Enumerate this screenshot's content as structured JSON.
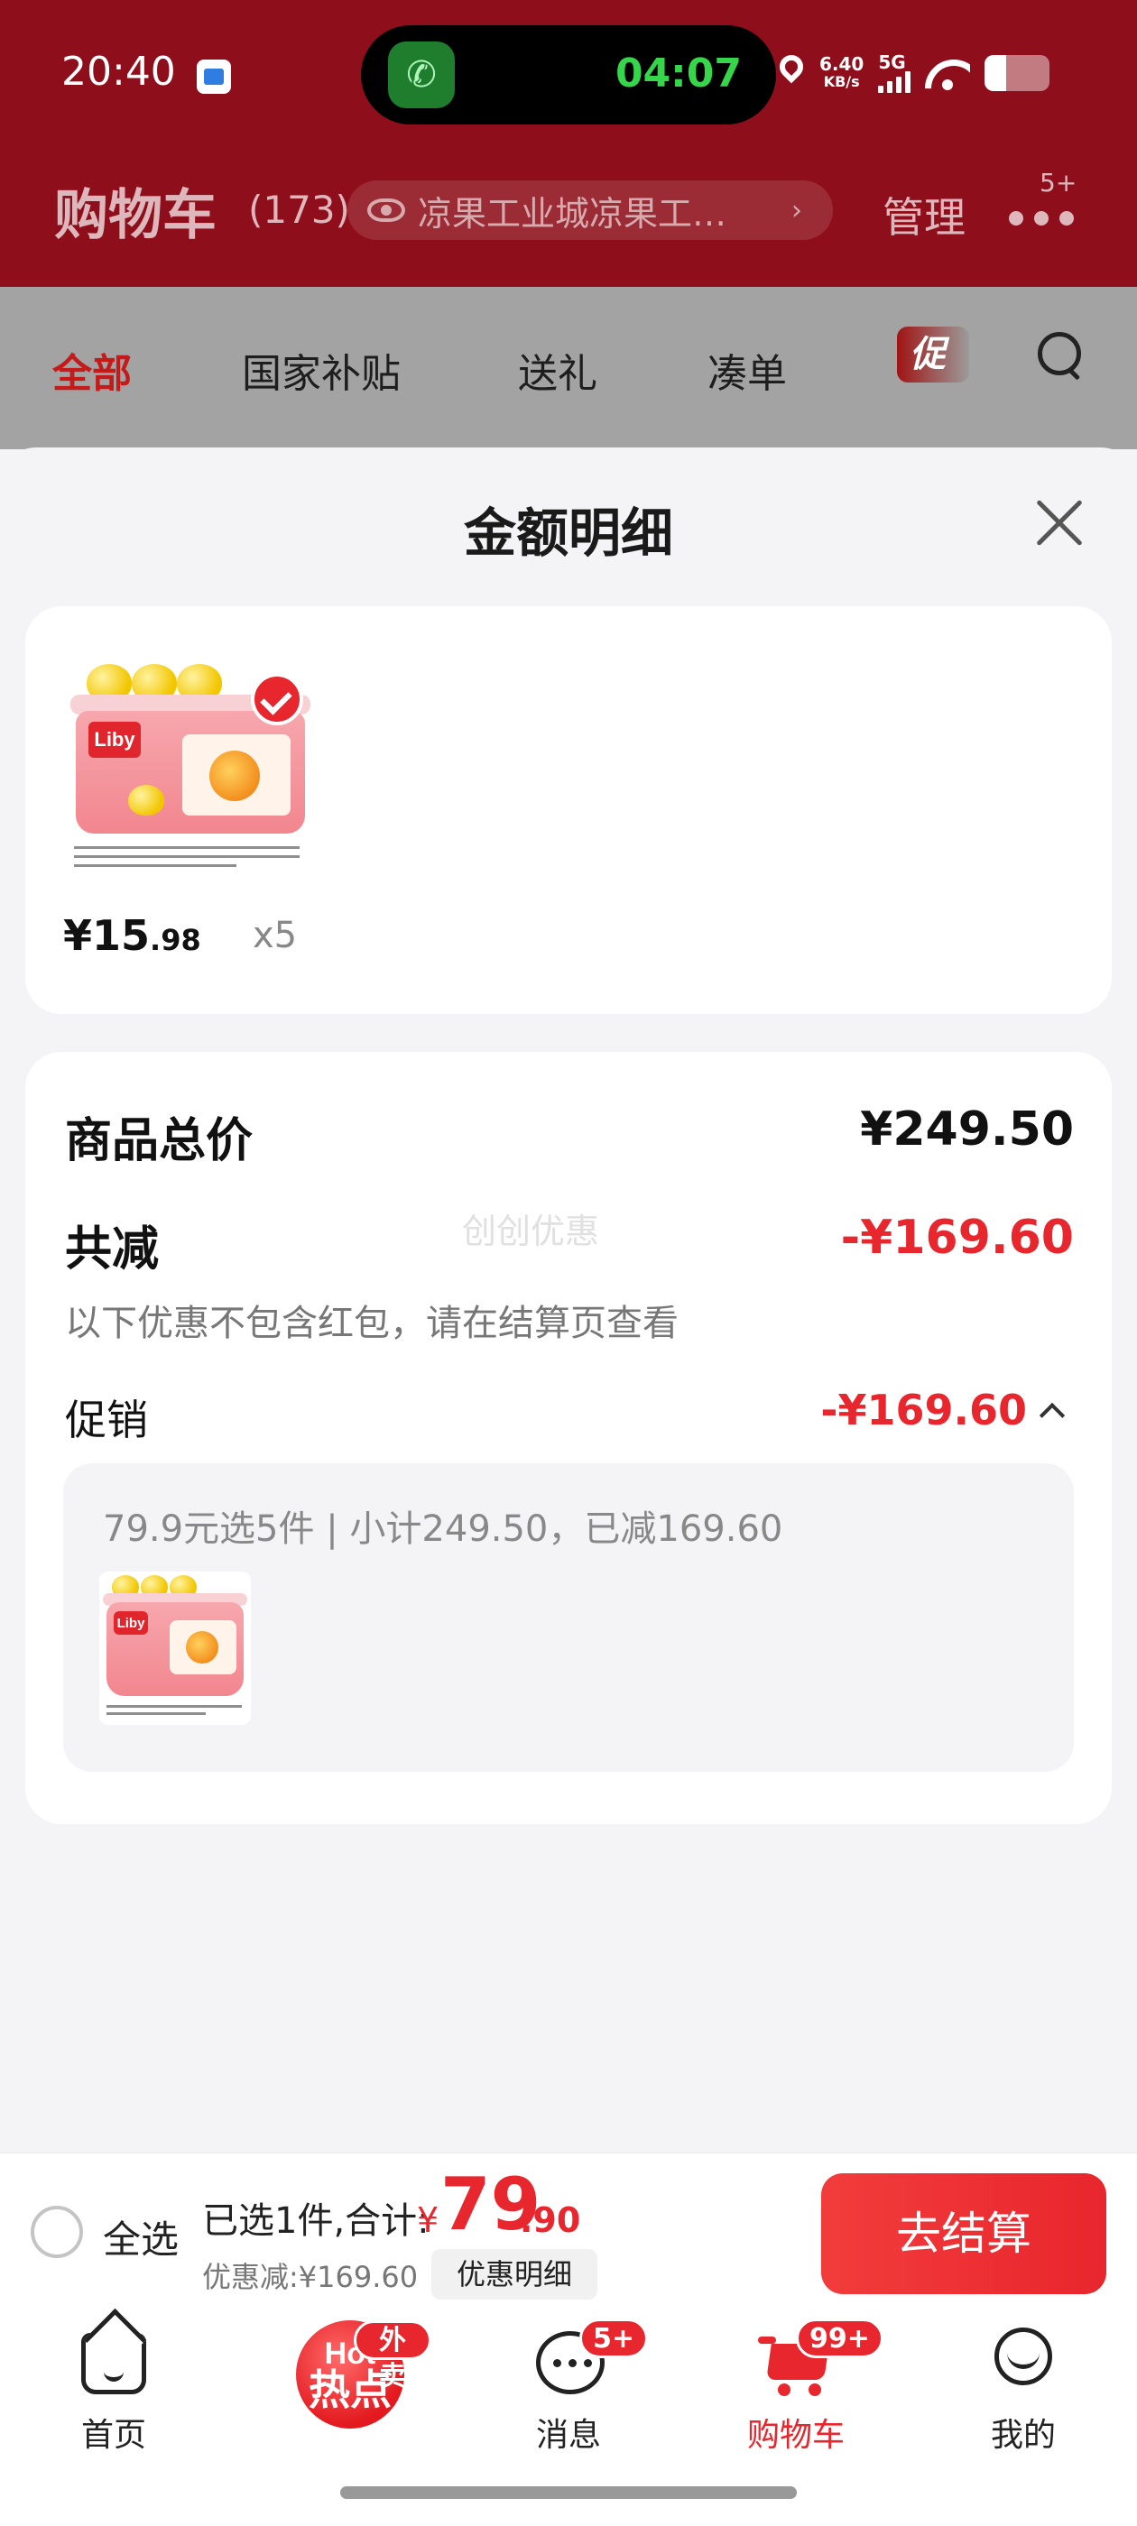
{
  "status_bar": {
    "time": "20:40",
    "call_timer": "04:07",
    "net_speed_value": "6.40",
    "net_speed_unit": "KB/s",
    "network": "5G"
  },
  "header": {
    "title": "购物车",
    "count": "(173)",
    "address": "凉果工业城凉果工…",
    "manage_label": "管理",
    "more_badge": "5+"
  },
  "tabs": {
    "items": [
      "全部",
      "国家补贴",
      "送礼",
      "凑单"
    ],
    "active_index": 0,
    "promo_tag": "促"
  },
  "sheet": {
    "title": "金额明细",
    "product": {
      "brand": "Liby",
      "price_int": "¥15",
      "price_dec": ".98",
      "quantity": "x5",
      "selected": true
    },
    "summary": {
      "total_label": "商品总价",
      "total_value": "¥249.50",
      "reduce_label": "共减",
      "reduce_value": "-¥169.60",
      "watermark": "创创优惠",
      "note": "以下优惠不包含红包，请在结算页查看",
      "promo_label": "促销",
      "promo_value": "-¥169.60",
      "promo_desc": "79.9元选5件 | 小计249.50，已减169.60"
    }
  },
  "checkout": {
    "select_all": "全选",
    "selected_text": "已选1件,合计:",
    "currency": "¥",
    "total_int": "79",
    "total_dec": ".90",
    "discount_text": "优惠减:¥169.60",
    "discount_detail_btn": "优惠明细",
    "checkout_btn": "去结算"
  },
  "bottom_nav": {
    "home": "首页",
    "hot_en": "Hot",
    "hot_cn": "热点",
    "hot_badge": "外卖",
    "messages": "消息",
    "messages_badge": "5+",
    "cart": "购物车",
    "cart_badge": "99+",
    "mine": "我的"
  },
  "colors": {
    "accent_red": "#e8262d",
    "header_red": "#8e0f1b",
    "call_green": "#36d64a"
  }
}
